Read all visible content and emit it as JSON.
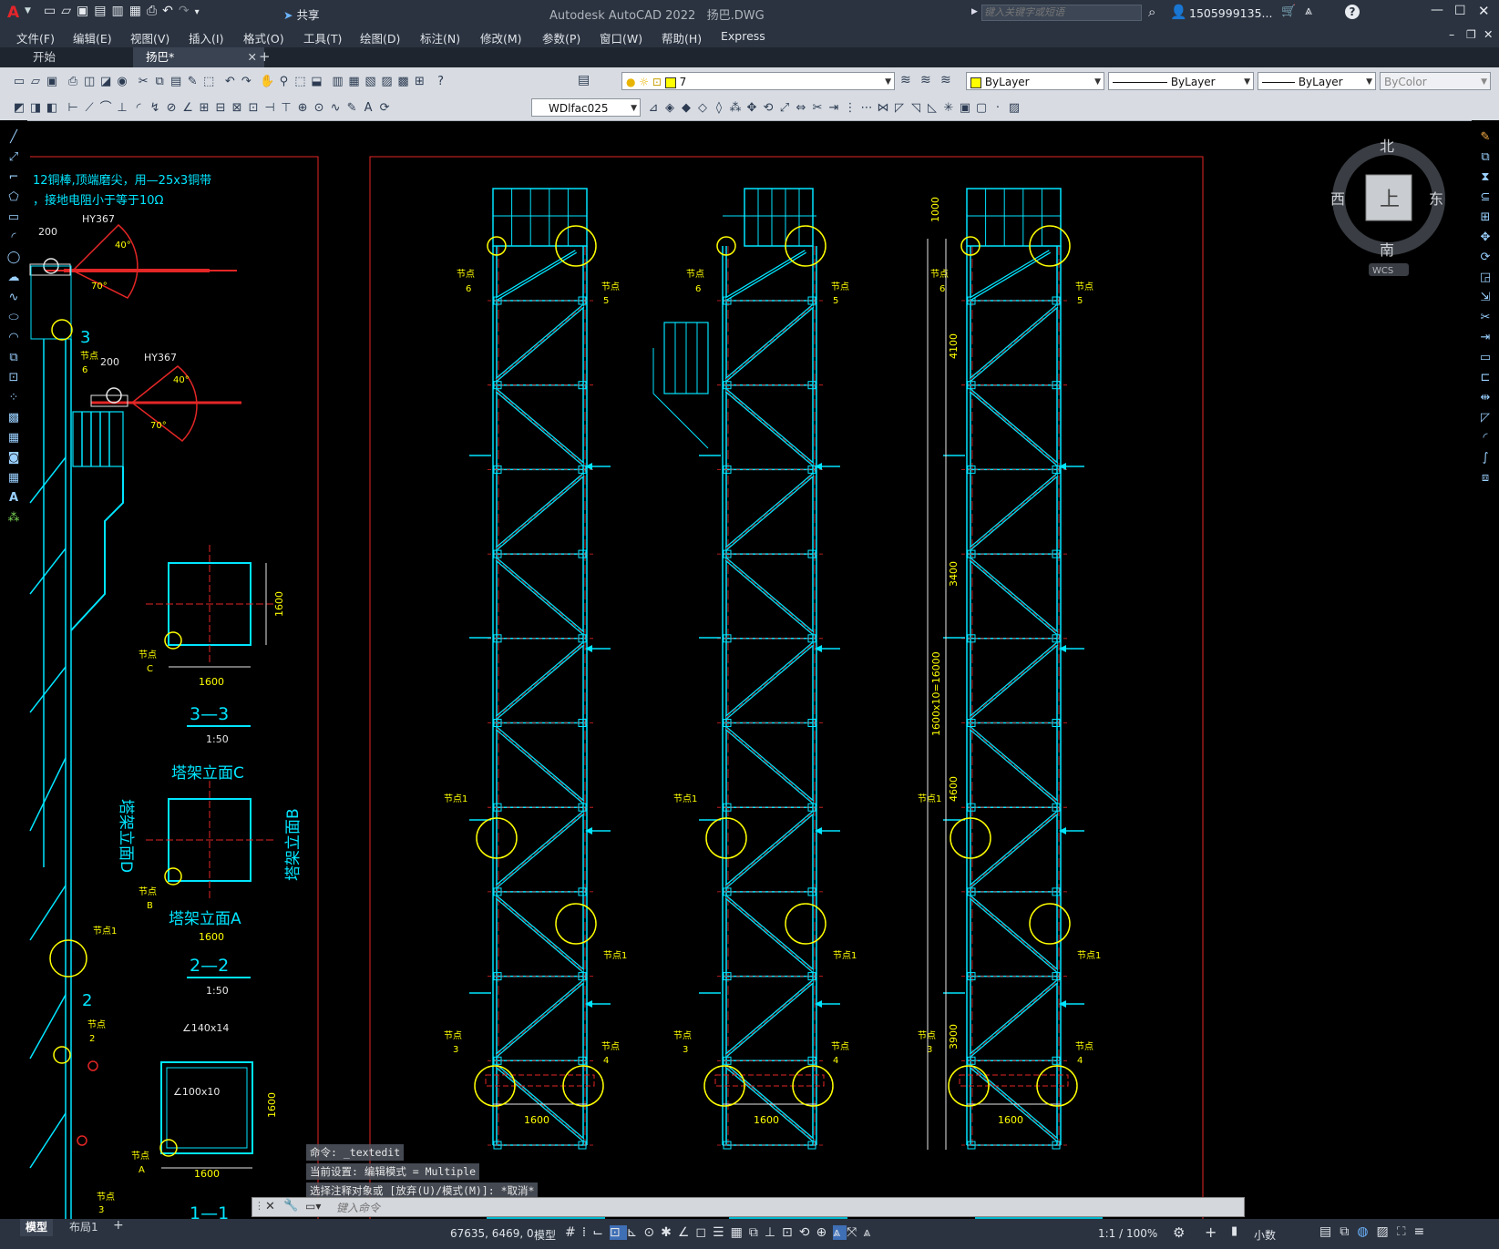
{
  "titlebar": {
    "app_title": "Autodesk AutoCAD 2022",
    "file_name": "扬巴.DWG",
    "share_label": "共享",
    "search_placeholder": "键入关键字或短语",
    "user": "1505999135..."
  },
  "menu": [
    "文件(F)",
    "编辑(E)",
    "视图(V)",
    "插入(I)",
    "格式(O)",
    "工具(T)",
    "绘图(D)",
    "标注(N)",
    "修改(M)",
    "参数(P)",
    "窗口(W)",
    "帮助(H)",
    "Express"
  ],
  "tabs": [
    {
      "label": "开始"
    },
    {
      "label": "扬巴*"
    }
  ],
  "toolbar": {
    "layer_value": "7",
    "color_value": "ByLayer",
    "linetype_value": "ByLayer",
    "lineweight_value": "ByLayer",
    "plotstyle_value": "ByColor",
    "dimstyle_value": "WDlfac025"
  },
  "viewcube": {
    "north": "北",
    "south": "南",
    "east": "东",
    "west": "西",
    "top": "上",
    "wcs": "WCS"
  },
  "drawing_text": {
    "note1": "12铜棒,顶端磨尖，用—25x3铜带",
    "note2": "，接地电阻小于等于10Ω",
    "dim200a": "200",
    "hy367a": "HY367",
    "ang40a": "40°",
    "ang70a": "70°",
    "sec3": "3",
    "node6_left": "节点",
    "node6_num": "6",
    "dim200b": "200",
    "hy367b": "HY367",
    "ang40b": "40°",
    "ang70b": "70°",
    "dim1600a": "1600",
    "dim1600a_v": "1600",
    "nodeC": "节点",
    "nodeC_l": "C",
    "sec33": "3—3",
    "scale1": "1:50",
    "elevC": "塔架立面C",
    "elevD": "塔架立面D",
    "elevB": "塔架立面B",
    "nodeB": "节点",
    "nodeB_l": "B",
    "elevA": "塔架立面A",
    "dim1600b": "1600",
    "sec22": "2—2",
    "scale2": "1:50",
    "node1_left": "节点1",
    "sec2": "2",
    "node2_left": "节点",
    "node2_num": "2",
    "angle140": "∠140x14",
    "angle100": "∠100x10",
    "dim1600c": "1600",
    "dim1600c_v": "1600",
    "nodeA": "节点",
    "nodeA_l": "A",
    "node3_left": "节点",
    "node3_num": "3",
    "sec11": "1—1",
    "dimBase": "1600",
    "node_label": "节点",
    "n1": "节点1",
    "n3": "3",
    "n4": "4",
    "n5": "5",
    "n6": "6",
    "dim1000": "1000",
    "dim4100": "4100",
    "dim3400": "3400",
    "dim4600": "4600",
    "dim3900": "3900",
    "dimTotal": "1600x10=16000"
  },
  "command": {
    "line1": "命令: _textedit",
    "line2": "当前设置: 编辑模式 = Multiple",
    "line3": "选择注释对象或 [放弃(U)/模式(M)]: *取消*",
    "placeholder": "键入命令"
  },
  "status": {
    "model_tab": "模型",
    "layout_tab": "布局1",
    "coords": "67635, 6469, 0",
    "space": "模型",
    "scale": "1:1 / 100%",
    "units": "小数"
  }
}
